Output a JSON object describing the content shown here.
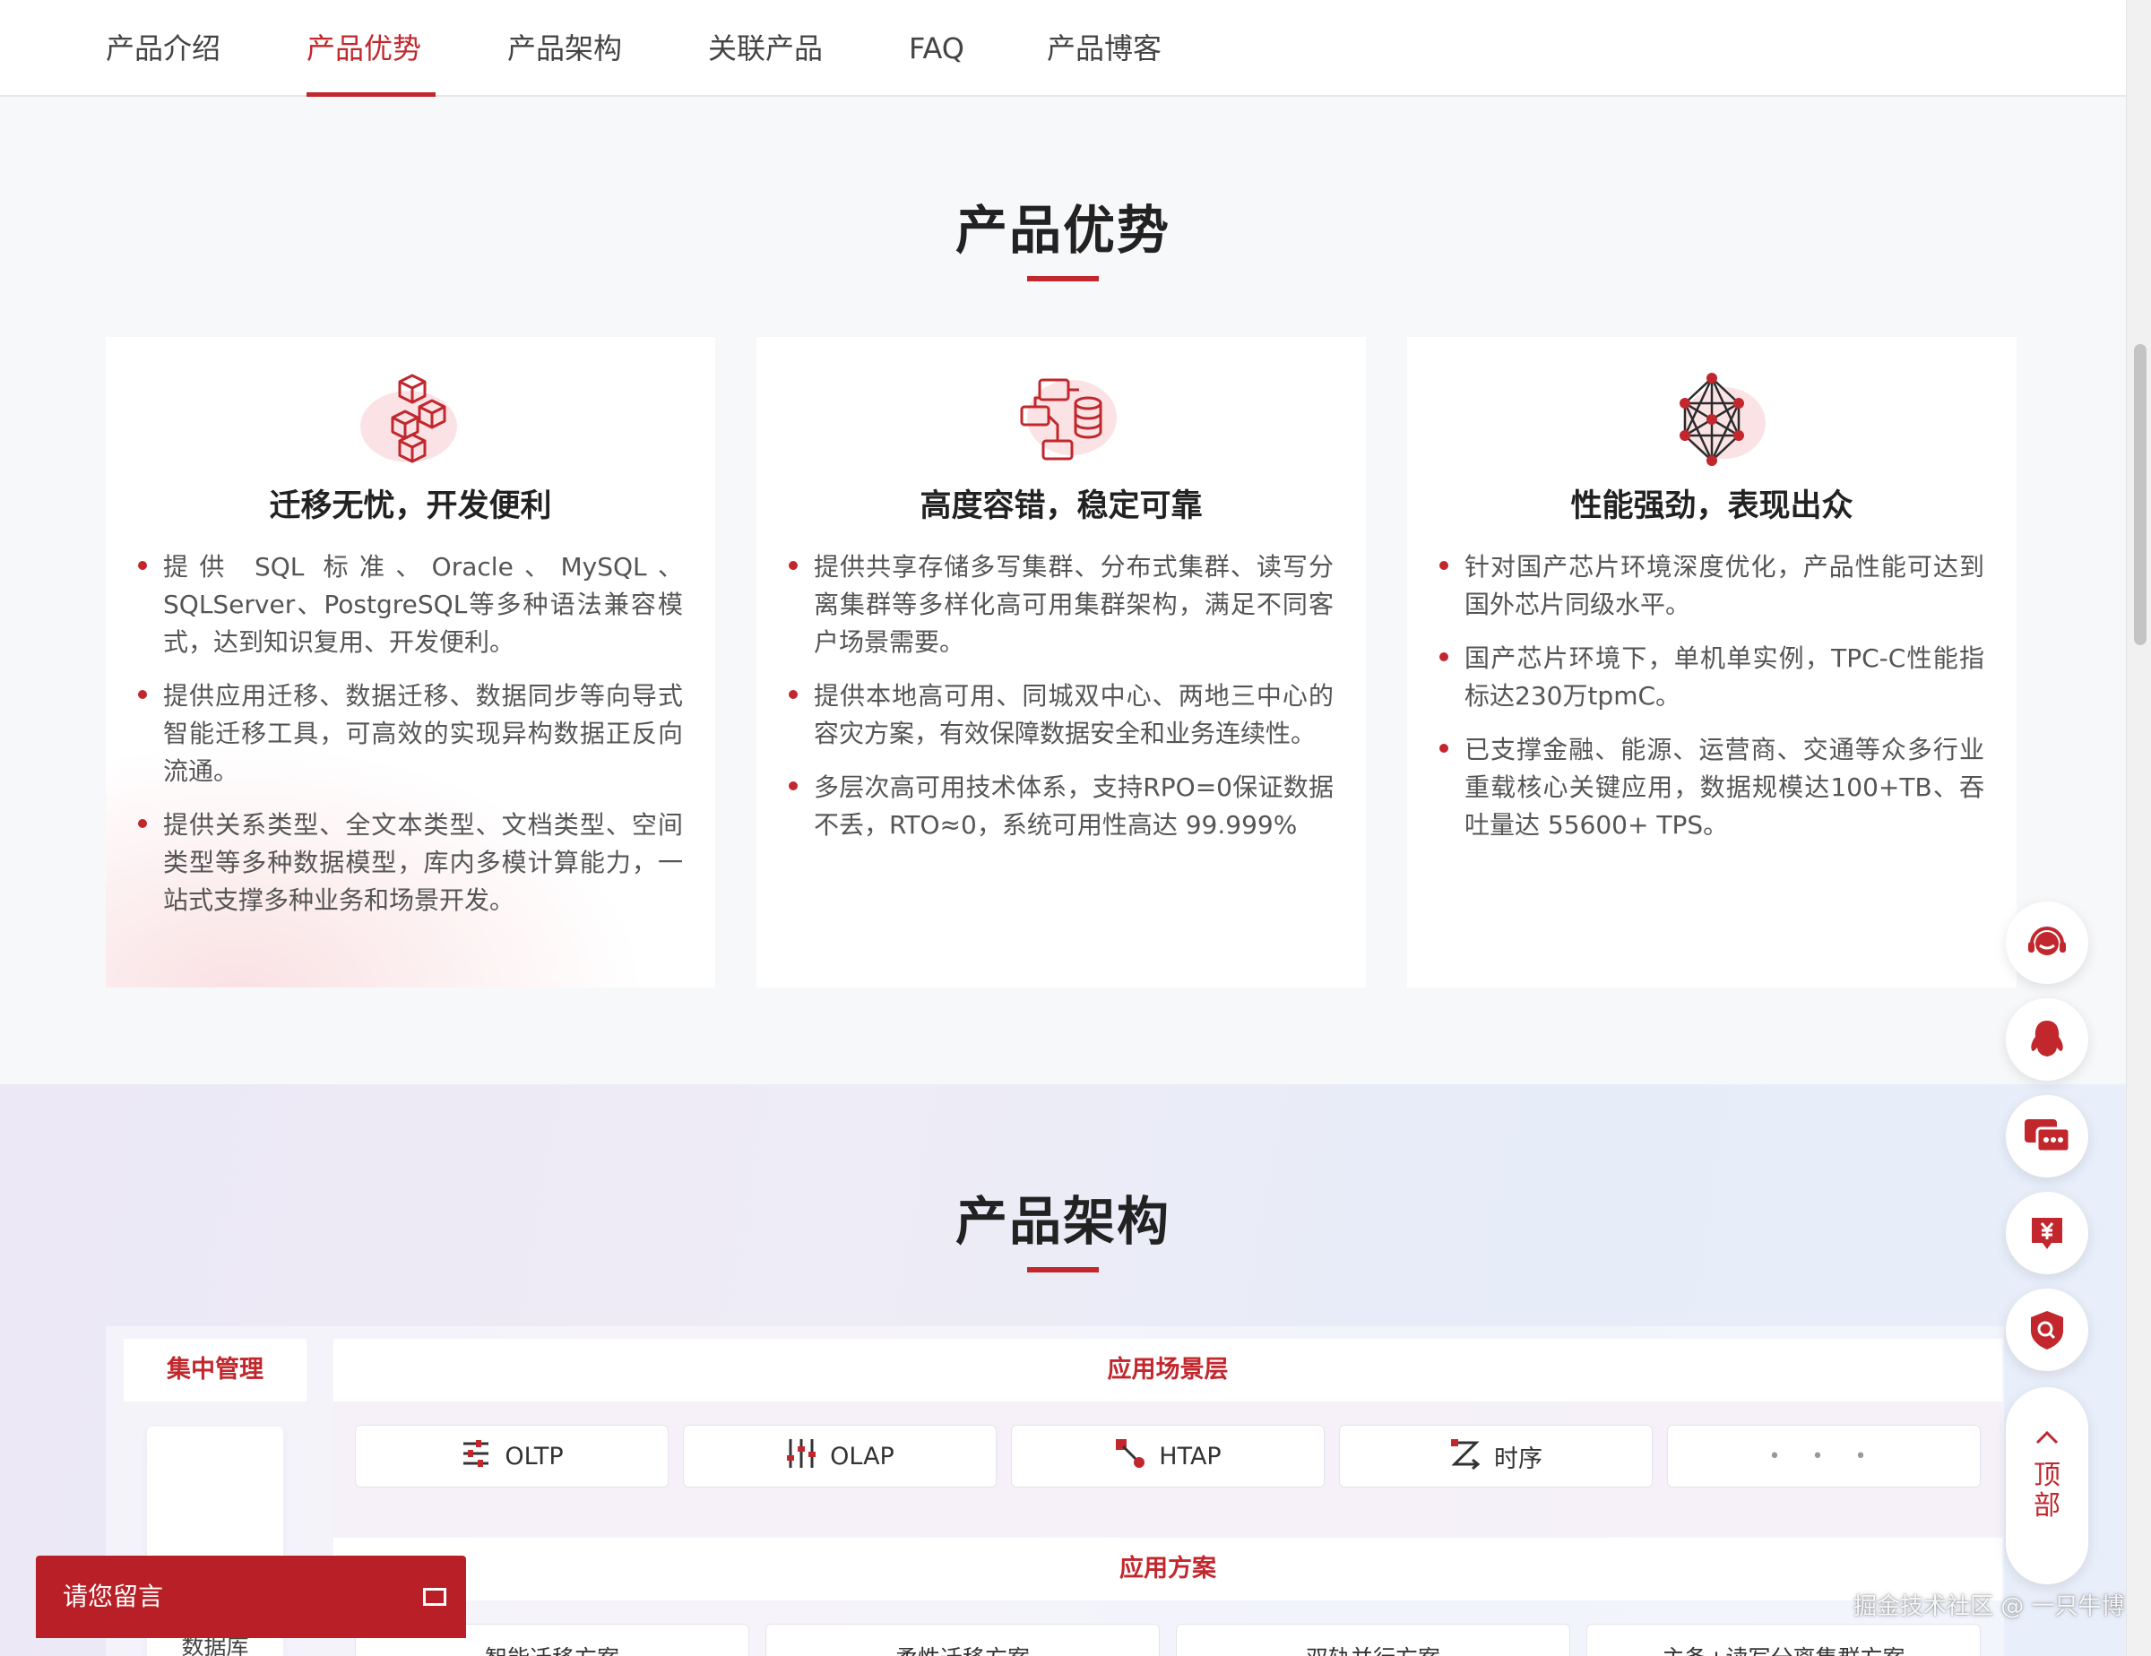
{
  "nav": {
    "tabs": [
      "产品介绍",
      "产品优势",
      "产品架构",
      "关联产品",
      "FAQ",
      "产品博客"
    ],
    "active": "产品优势"
  },
  "advantages": {
    "title": "产品优势",
    "cards": [
      {
        "icon": "cubes-icon",
        "title": "迁移无忧，开发便利",
        "items": [
          "提供 SQL 标准、Oracle、MySQL、SQLServer、PostgreSQL等多种语法兼容模式，达到知识复用、开发便利。",
          "提供应用迁移、数据迁移、数据同步等向导式智能迁移工具，可高效的实现异构数据正反向流通。",
          "提供关系类型、全文本类型、文档类型、空间类型等多种数据模型，库内多模计算能力，一站式支撑多种业务和场景开发。"
        ]
      },
      {
        "icon": "cluster-database-icon",
        "title": "高度容错，稳定可靠",
        "items": [
          "提供共享存储多写集群、分布式集群、读写分离集群等多样化高可用集群架构，满足不同客户场景需要。",
          "提供本地高可用、同城双中心、两地三中心的容灾方案，有效保障数据安全和业务连续性。",
          "多层次高可用技术体系，支持RPO=0保证数据不丢，RTO≈0，系统可用性高达 99.999%"
        ]
      },
      {
        "icon": "network-mesh-icon",
        "title": "性能强劲，表现出众",
        "items": [
          "针对国产芯片环境深度优化，产品性能可达到国外芯片同级水平。",
          "国产芯片环境下，单机单实例，TPC-C性能指标达230万tpmC。",
          "已支撑金融、能源、运营商、交通等众多行业重载核心关键应用，数据规模达100+TB、吞吐量达 55600+ TPS。"
        ]
      }
    ]
  },
  "architecture": {
    "title": "产品架构",
    "management": {
      "head": "集中管理",
      "label": "数据库"
    },
    "scene_layer": {
      "head": "应用场景层",
      "items": [
        {
          "label": "OLTP",
          "icon": "sliders-icon"
        },
        {
          "label": "OLAP",
          "icon": "bars-icon"
        },
        {
          "label": "HTAP",
          "icon": "flow-icon"
        },
        {
          "label": "时序",
          "icon": "z-arrows-icon"
        },
        {
          "label": "• • •",
          "icon": ""
        }
      ]
    },
    "solutions": {
      "head": "应用方案",
      "items": [
        "智能迁移方案",
        "柔性迁移方案",
        "双轨并行方案",
        "主备+读写分离集群方案"
      ]
    }
  },
  "float_toolbar": {
    "buttons": [
      "headset-icon",
      "qq-penguin-icon",
      "chat-bubbles-icon",
      "yuan-tag-icon",
      "shield-search-icon"
    ],
    "top_label": "顶部"
  },
  "message_bar": {
    "label": "请您留言"
  },
  "watermark": "掘金技术社区 @ 一只牛博",
  "colors": {
    "accent": "#c1272d"
  }
}
